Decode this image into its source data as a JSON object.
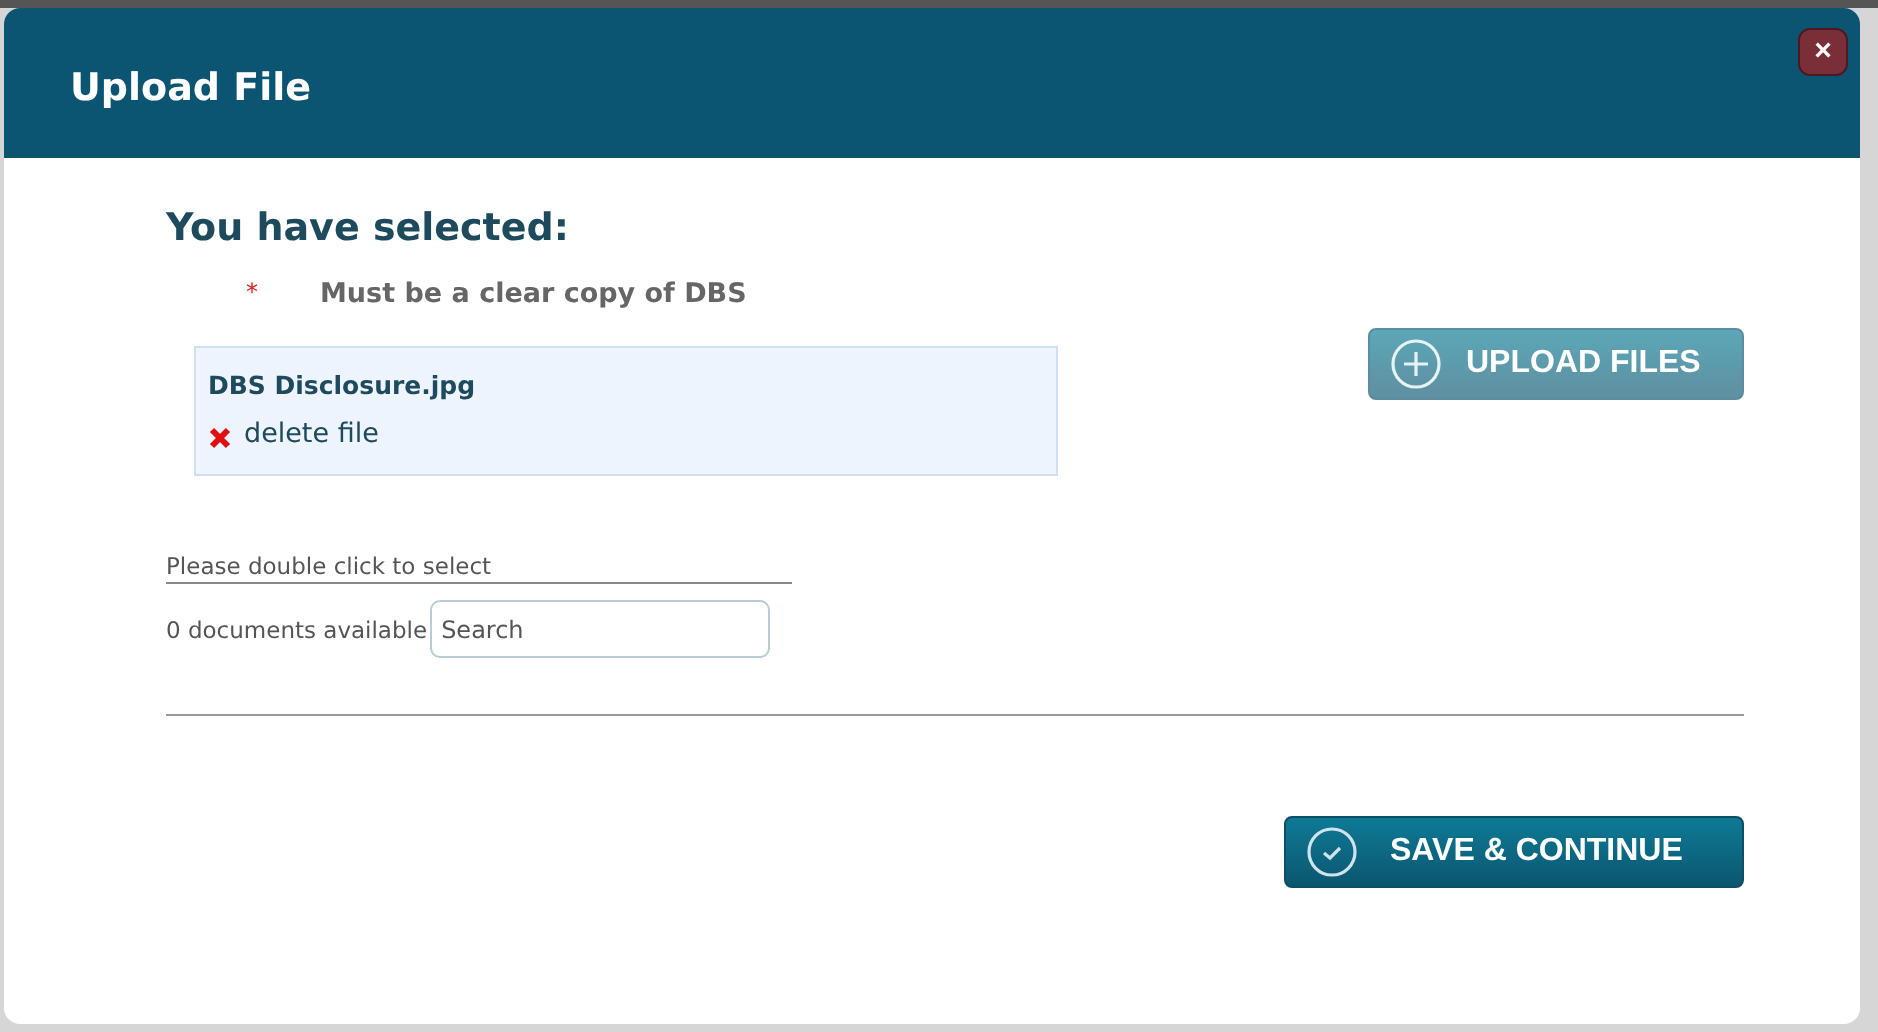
{
  "dialog": {
    "title": "Upload File",
    "close_label": "×"
  },
  "heading": "You have selected:",
  "requirement": {
    "marker": "*",
    "text": "Must be a clear copy of DBS"
  },
  "selected_files": [
    {
      "name": "DBS Disclosure.jpg",
      "delete_label": "delete file"
    }
  ],
  "upload_button": "UPLOAD FILES",
  "document_picker": {
    "hint": "Please double click to select",
    "count": "0 documents available",
    "search": {
      "placeholder": "Search"
    }
  },
  "save_button": "SAVE & CONTINUE"
}
